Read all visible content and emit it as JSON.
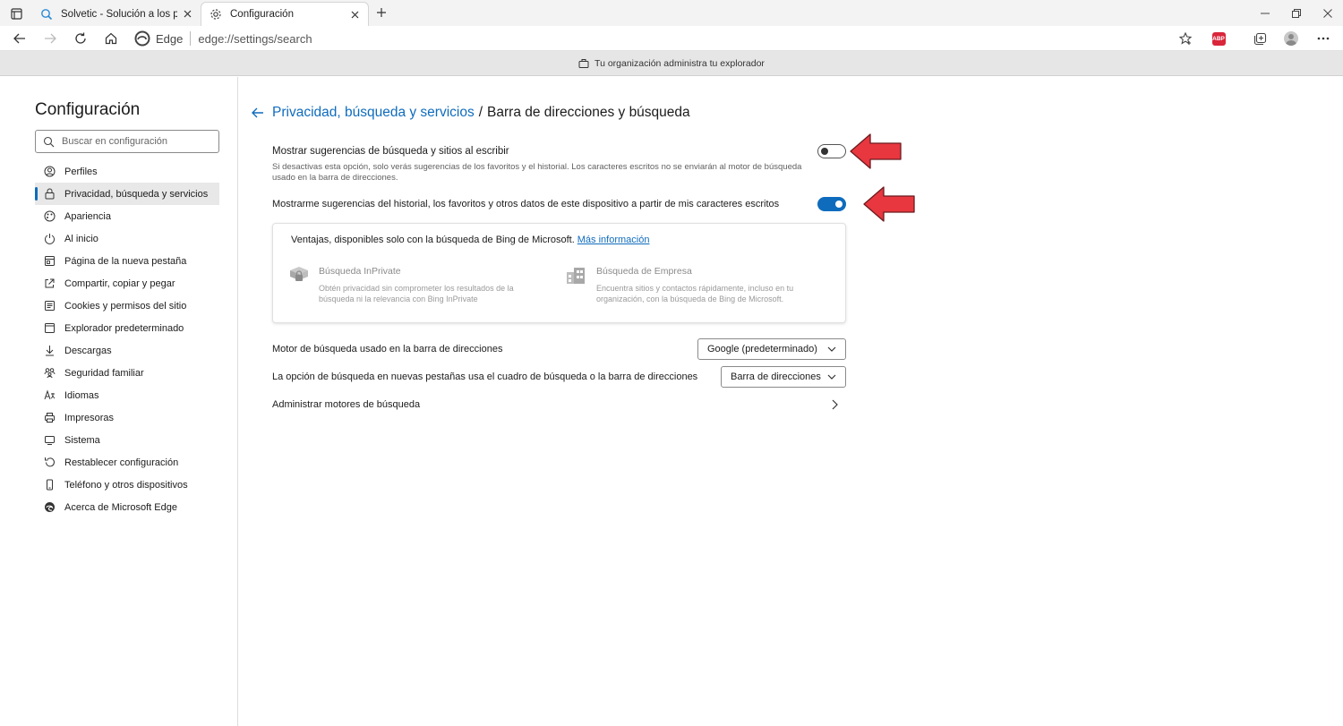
{
  "browser": {
    "tabs": [
      {
        "title": "Solvetic - Solución a los problem",
        "active": false
      },
      {
        "title": "Configuración",
        "active": true
      }
    ],
    "address": {
      "brand": "Edge",
      "url": "edge://settings/search"
    },
    "banner": "Tu organización administra tu explorador"
  },
  "sidebar": {
    "title": "Configuración",
    "search_placeholder": "Buscar en configuración",
    "items": [
      {
        "label": "Perfiles",
        "icon": "profile-icon"
      },
      {
        "label": "Privacidad, búsqueda y servicios",
        "icon": "lock-icon",
        "selected": true
      },
      {
        "label": "Apariencia",
        "icon": "appearance-icon"
      },
      {
        "label": "Al inicio",
        "icon": "power-icon"
      },
      {
        "label": "Página de la nueva pestaña",
        "icon": "new-tab-page-icon"
      },
      {
        "label": "Compartir, copiar y pegar",
        "icon": "share-icon"
      },
      {
        "label": "Cookies y permisos del sitio",
        "icon": "cookies-icon"
      },
      {
        "label": "Explorador predeterminado",
        "icon": "default-browser-icon"
      },
      {
        "label": "Descargas",
        "icon": "download-icon"
      },
      {
        "label": "Seguridad familiar",
        "icon": "family-icon"
      },
      {
        "label": "Idiomas",
        "icon": "language-icon"
      },
      {
        "label": "Impresoras",
        "icon": "printer-icon"
      },
      {
        "label": "Sistema",
        "icon": "system-icon"
      },
      {
        "label": "Restablecer configuración",
        "icon": "reset-icon"
      },
      {
        "label": "Teléfono y otros dispositivos",
        "icon": "phone-icon"
      },
      {
        "label": "Acerca de Microsoft Edge",
        "icon": "edge-icon"
      }
    ]
  },
  "main": {
    "breadcrumb": {
      "parent": "Privacidad, búsqueda y servicios",
      "separator": "/",
      "current": "Barra de direcciones y búsqueda"
    },
    "setting1": {
      "title": "Mostrar sugerencias de búsqueda y sitios al escribir",
      "description": "Si desactivas esta opción, solo verás sugerencias de los favoritos y el historial. Los caracteres escritos no se enviarán al motor de búsqueda usado en la barra de direcciones.",
      "enabled": false
    },
    "setting2": {
      "title": "Mostrarme sugerencias del historial, los favoritos y otros datos de este dispositivo a partir de mis caracteres escritos",
      "enabled": true
    },
    "bing_card": {
      "heading": "Ventajas, disponibles solo con la búsqueda de Bing de Microsoft.",
      "link": "Más información",
      "features": [
        {
          "title": "Búsqueda InPrivate",
          "description": "Obtén privacidad sin comprometer los resultados de la búsqueda ni la relevancia con Bing InPrivate",
          "icon": "inprivate-search-icon"
        },
        {
          "title": "Búsqueda de Empresa",
          "description": "Encuentra sitios y contactos rápidamente, incluso en tu organización, con la búsqueda de Bing de Microsoft.",
          "icon": "enterprise-search-icon"
        }
      ]
    },
    "search_engine": {
      "label": "Motor de búsqueda usado en la barra de direcciones",
      "value": "Google (predeterminado)"
    },
    "new_tab_search": {
      "label": "La opción de búsqueda en nuevas pestañas usa el cuadro de búsqueda o la barra de direcciones",
      "value": "Barra de direcciones"
    },
    "manage_engines": {
      "label": "Administrar motores de búsqueda"
    }
  },
  "annotations": {
    "arrow_color": "#e8373f"
  },
  "colors": {
    "accent": "#0f6cbd"
  }
}
